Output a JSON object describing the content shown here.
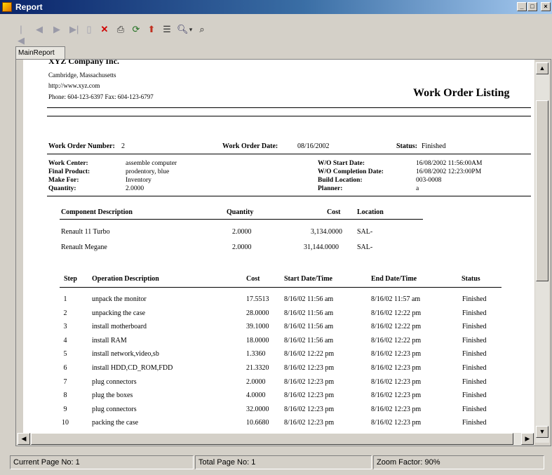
{
  "window": {
    "title": "Report"
  },
  "toolbar": {
    "buttons": [
      "first-page",
      "previous-page",
      "next-page",
      "last-page",
      "page",
      "close",
      "print",
      "refresh",
      "export",
      "toggle-tree",
      "zoom",
      "search"
    ]
  },
  "tabs": [
    {
      "label": "MainReport"
    }
  ],
  "report": {
    "company": {
      "name": "XYZ Company Inc.",
      "city": "Cambridge, Massachusetts",
      "url": "http://www.xyz.com",
      "phone_fax": "Phone: 604-123-6397  Fax: 604-123-6797"
    },
    "title": "Work Order Listing",
    "order": {
      "number_label": "Work Order Number:",
      "number": "2",
      "date_label": "Work Order  Date:",
      "date": "08/16/2002",
      "status_label": "Status:",
      "status": "Finished",
      "left_fields": [
        {
          "label": "Work Center:",
          "value": "assemble computer"
        },
        {
          "label": "Final Product:",
          "value": "prodentory, blue"
        },
        {
          "label": "Make For:",
          "value": "Inventory"
        },
        {
          "label": "Quantity:",
          "value": "2.0000"
        }
      ],
      "right_fields": [
        {
          "label": "W/O Start Date:",
          "value": "16/08/2002  11:56:00AM"
        },
        {
          "label": "W/O Completion Date:",
          "value": "16/08/2002  12:23:00PM"
        },
        {
          "label": "Build Location:",
          "value": "003-0008"
        },
        {
          "label": "Planner:",
          "value": "a"
        }
      ]
    },
    "components": {
      "headers": [
        "Component Description",
        "Quantity",
        "Cost",
        "Location"
      ],
      "rows": [
        [
          "Renault 11 Turbo",
          "2.0000",
          "3,134.0000",
          "SAL-"
        ],
        [
          "Renault Megane",
          "2.0000",
          "31,144.0000",
          "SAL-"
        ]
      ]
    },
    "operations": {
      "headers": [
        "Step",
        "Operation Description",
        "Cost",
        "Start Date/Time",
        "End  Date/Time",
        "Status"
      ],
      "rows": [
        [
          "1",
          "unpack the monitor",
          "17.5513",
          "8/16/02  11:56 am",
          "8/16/02  11:57 am",
          "Finished"
        ],
        [
          "2",
          "unpacking the case",
          "28.0000",
          "8/16/02  11:56 am",
          "8/16/02  12:22 pm",
          "Finished"
        ],
        [
          "3",
          "install motherboard",
          "39.1000",
          "8/16/02  11:56 am",
          "8/16/02  12:22 pm",
          "Finished"
        ],
        [
          "4",
          "install RAM",
          "18.0000",
          "8/16/02  11:56 am",
          "8/16/02  12:22 pm",
          "Finished"
        ],
        [
          "5",
          "install network,video,sb",
          "1.3360",
          "8/16/02  12:22 pm",
          "8/16/02  12:23 pm",
          "Finished"
        ],
        [
          "6",
          "install HDD,CD_ROM,FDD",
          "21.3320",
          "8/16/02  12:23 pm",
          "8/16/02  12:23 pm",
          "Finished"
        ],
        [
          "7",
          "plug connectors",
          "2.0000",
          "8/16/02  12:23 pm",
          "8/16/02  12:23 pm",
          "Finished"
        ],
        [
          "8",
          "plug the boxes",
          "4.0000",
          "8/16/02  12:23 pm",
          "8/16/02  12:23 pm",
          "Finished"
        ],
        [
          "9",
          "plug connectors",
          "32.0000",
          "8/16/02  12:23 pm",
          "8/16/02  12:23 pm",
          "Finished"
        ],
        [
          "10",
          "packing the case",
          "10.6680",
          "8/16/02  12:23 pm",
          "8/16/02  12:23 pm",
          "Finished"
        ]
      ]
    }
  },
  "status": {
    "current_page": "Current Page No: 1",
    "total_pages": "Total Page No: 1",
    "zoom": "Zoom Factor: 90%"
  }
}
